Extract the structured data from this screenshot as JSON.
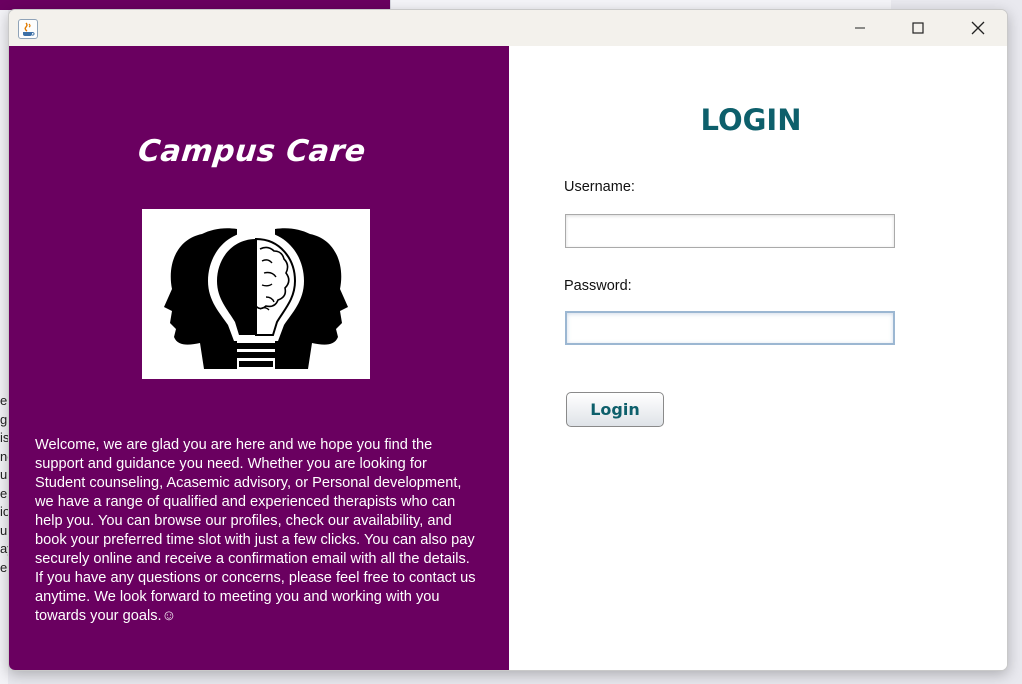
{
  "window": {
    "controls": {
      "minimize": "—",
      "maximize": "☐",
      "close": "✕"
    }
  },
  "brand": {
    "title": "Campus Care",
    "logo_icon": "head-lightbulb-brain-icon"
  },
  "welcome_text": "Welcome, we are glad you are here and we hope you find the\nsupport and guidance you need. Whether you are looking for\nStudent counseling, Acasemic advisory, or Personal development,\nwe have a range of qualified and experienced therapists who can\nhelp you. You can browse our profiles, check our availability, and\nbook your preferred time slot with just a few clicks. You can also pay\nsecurely online and receive a confirmation email with all the details.\nIf you have any questions or concerns, please feel free to contact us\nanytime. We look forward to meeting you and working with you\ntowards your goals.☺",
  "login": {
    "heading": "LOGIN",
    "username_label": "Username:",
    "username_value": "",
    "password_label": "Password:",
    "password_value": "",
    "button_label": "Login"
  },
  "background_window_text": "e\ng\nis\nno\nu\ne\nio\nu\nay\ne",
  "colors": {
    "brand_purple": "#6a0060",
    "accent_teal": "#0d5f6b",
    "titlebar": "#f3f1ec"
  }
}
